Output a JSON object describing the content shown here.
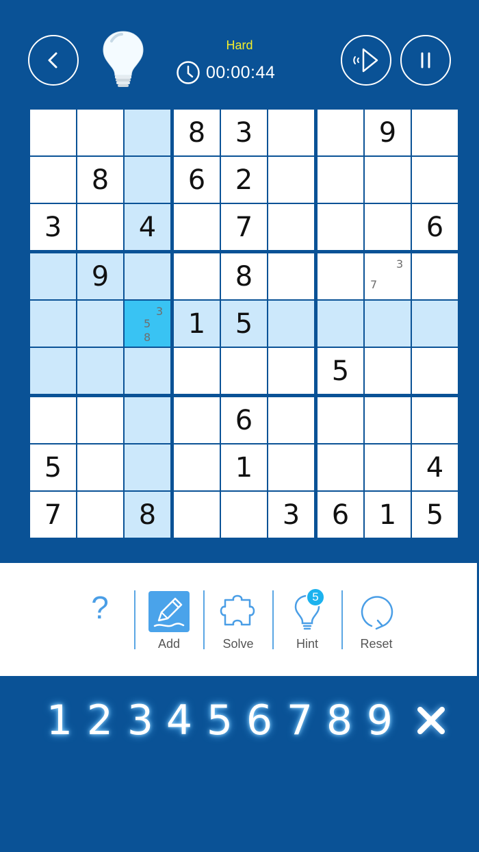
{
  "header": {
    "difficulty": "Hard",
    "timer": "00:00:44",
    "icons": [
      "back-icon",
      "lightbulb-icon",
      "clock-icon",
      "sound-icon",
      "pause-icon"
    ]
  },
  "board": {
    "rows": [
      [
        "",
        "",
        "",
        "8",
        "3",
        "",
        "",
        "9",
        ""
      ],
      [
        "",
        "8",
        "",
        "6",
        "2",
        "",
        "",
        "",
        ""
      ],
      [
        "3",
        "",
        "4",
        "",
        "7",
        "",
        "",
        "",
        "6"
      ],
      [
        "",
        "9",
        "",
        "",
        "8",
        "",
        "",
        "",
        ""
      ],
      [
        "",
        "",
        "",
        "1",
        "5",
        "",
        "",
        "",
        ""
      ],
      [
        "",
        "",
        "",
        "",
        "",
        "",
        "5",
        "",
        ""
      ],
      [
        "",
        "",
        "",
        "",
        "6",
        "",
        "",
        "",
        ""
      ],
      [
        "5",
        "",
        "",
        "",
        "1",
        "",
        "",
        "",
        "4"
      ],
      [
        "7",
        "",
        "8",
        "",
        "",
        "3",
        "6",
        "1",
        "5"
      ]
    ],
    "notes": [
      {
        "row": 3,
        "col": 7,
        "digits": [
          "3",
          "7"
        ]
      },
      {
        "row": 4,
        "col": 2,
        "digits": [
          "3",
          "5",
          "8"
        ]
      }
    ],
    "selected": {
      "row": 4,
      "col": 2
    },
    "colors": {
      "highlight": "#cce8fb",
      "selected": "#39c3f3",
      "grid": "#0a5296"
    }
  },
  "toolbar": {
    "help_label": "?",
    "add_label": "Add",
    "solve_label": "Solve",
    "hint_label": "Hint",
    "hint_count": "5",
    "reset_label": "Reset"
  },
  "numpad": {
    "digits": [
      "1",
      "2",
      "3",
      "4",
      "5",
      "6",
      "7",
      "8",
      "9"
    ]
  },
  "theme": {
    "primary": "#0a5296",
    "accent": "#4a9ee6",
    "difficulty_color": "#f5ee2a"
  }
}
